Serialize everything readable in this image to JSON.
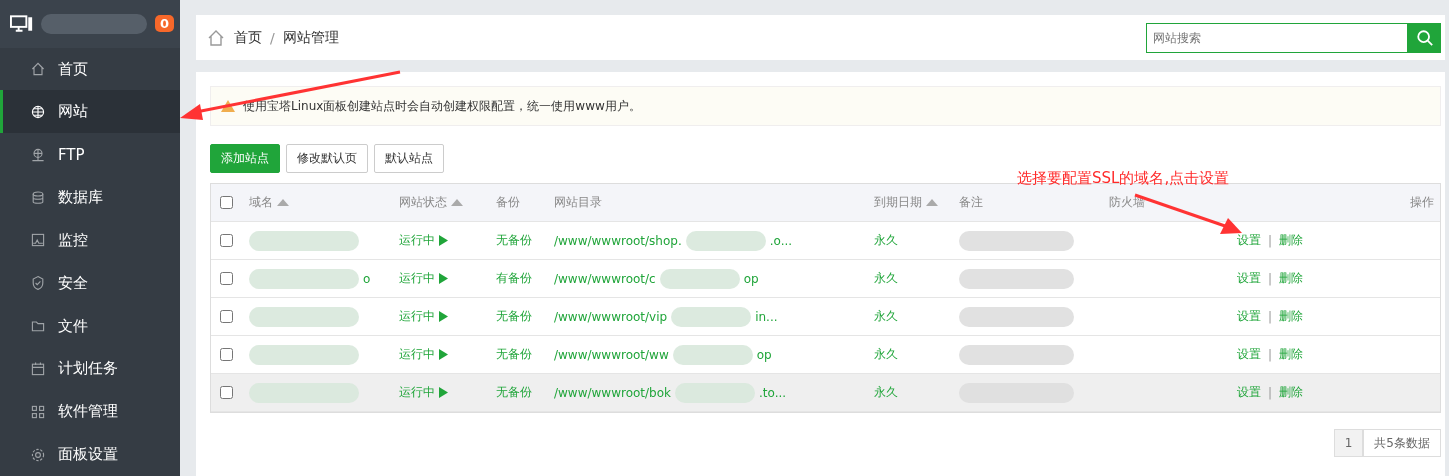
{
  "sidebar": {
    "badge": "0",
    "items": [
      {
        "label": "首页",
        "selected": false
      },
      {
        "label": "网站",
        "selected": true
      },
      {
        "label": "FTP",
        "selected": false
      },
      {
        "label": "数据库",
        "selected": false
      },
      {
        "label": "监控",
        "selected": false
      },
      {
        "label": "安全",
        "selected": false
      },
      {
        "label": "文件",
        "selected": false
      },
      {
        "label": "计划任务",
        "selected": false
      },
      {
        "label": "软件管理",
        "selected": false
      },
      {
        "label": "面板设置",
        "selected": false
      }
    ]
  },
  "breadcrumb": [
    "首页",
    "/",
    "网站管理"
  ],
  "search": {
    "placeholder": "网站搜索"
  },
  "notice": "使用宝塔Linux面板创建站点时会自动创建权限配置，统一使用www用户。",
  "buttons": [
    {
      "label": "添加站点",
      "kind": "primary"
    },
    {
      "label": "修改默认页",
      "kind": "default"
    },
    {
      "label": "默认站点",
      "kind": "default"
    }
  ],
  "table": {
    "all_checked": false,
    "columns": [
      {
        "label": "域名",
        "sortable": true
      },
      {
        "label": "网站状态",
        "sortable": true
      },
      {
        "label": "备份",
        "sortable": false
      },
      {
        "label": "网站目录",
        "sortable": false
      },
      {
        "label": "到期日期",
        "sortable": true
      },
      {
        "label": "备注",
        "sortable": false
      },
      {
        "label": "防火墙",
        "sortable": false
      },
      {
        "label": "操作",
        "sortable": false
      }
    ],
    "rows": [
      {
        "checked": false,
        "hovered": false,
        "domain_suffix": "",
        "status": "运行中",
        "backup": "无备份",
        "path": "/www/wwwroot/shop.",
        "path_end": ".o...",
        "expiry": "永久",
        "actions": [
          "设置",
          "删除"
        ],
        "separator": "|"
      },
      {
        "checked": false,
        "hovered": false,
        "domain_suffix": "o",
        "status": "运行中",
        "backup": "有备份",
        "path": "/www/wwwroot/c",
        "path_end": "op",
        "expiry": "永久",
        "actions": [
          "设置",
          "删除"
        ],
        "separator": "|"
      },
      {
        "checked": false,
        "hovered": false,
        "domain_suffix": "",
        "status": "运行中",
        "backup": "无备份",
        "path": "/www/wwwroot/vip",
        "path_end": "in...",
        "expiry": "永久",
        "actions": [
          "设置",
          "删除"
        ],
        "separator": "|"
      },
      {
        "checked": false,
        "hovered": false,
        "domain_suffix": "",
        "status": "运行中",
        "backup": "无备份",
        "path": "/www/wwwroot/ww",
        "path_end": "op",
        "expiry": "永久",
        "actions": [
          "设置",
          "删除"
        ],
        "separator": "|"
      },
      {
        "checked": false,
        "hovered": true,
        "domain_suffix": "",
        "status": "运行中",
        "backup": "无备份",
        "path": "/www/wwwroot/bok",
        "path_end": ".to...",
        "expiry": "永久",
        "actions": [
          "设置",
          "删除"
        ],
        "separator": "|"
      }
    ]
  },
  "pagination": {
    "page": "1",
    "summary": "共5条数据"
  },
  "annotation": "选择要配置SSL的域名,点击设置"
}
